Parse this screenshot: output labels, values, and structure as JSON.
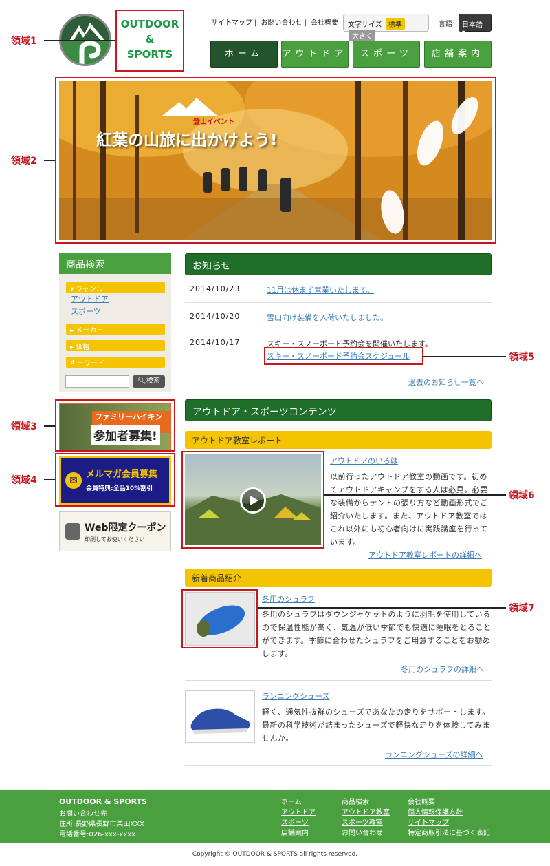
{
  "header": {
    "logo_line1": "OUTDOOR",
    "logo_line2": "&",
    "logo_line3": "SPORTS",
    "util_links": [
      "サイトマップ",
      "お問い合わせ",
      "会社概要"
    ],
    "font_size_label": "文字サイズ",
    "font_size_normal": "標準",
    "font_size_large": "大きく",
    "lang_label": "言語",
    "lang_value": "日本語"
  },
  "nav": [
    {
      "label": "ホーム",
      "active": true
    },
    {
      "label": "アウトドア",
      "active": false
    },
    {
      "label": "スポーツ",
      "active": false
    },
    {
      "label": "店舗案内",
      "active": false
    }
  ],
  "hero": {
    "event_label": "登山イベント",
    "title": "紅葉の山旅に出かけよう!"
  },
  "annotations": [
    "領域1",
    "領域2",
    "領域3",
    "領域4",
    "領域5",
    "領域6",
    "領域7"
  ],
  "sidebar": {
    "title": "商品検索",
    "genre_label": "ジャンル",
    "genre_items": [
      "アウトドア",
      "スポーツ"
    ],
    "maker_label": "メーカー",
    "price_label": "価格",
    "keyword_label": "キーワード",
    "search_button": "検索",
    "banner1_line1": "ファミリーハイキング",
    "banner1_line2": "参加者募集!",
    "banner2_line1": "メルマガ会員募集",
    "banner2_line2": "会員特典:全品10%割引",
    "banner3_line1": "Web限定クーポン",
    "banner3_line2": "印刷してお使いください"
  },
  "news": {
    "title": "お知らせ",
    "items": [
      {
        "date": "2014/10/23",
        "text": "11月は休まず営業いたします。"
      },
      {
        "date": "2014/10/20",
        "text": "雪山向け装備を入荷いたしました。"
      },
      {
        "date": "2014/10/17",
        "text": "スキー・スノーボード予約会を開催いたします。",
        "link": "スキー・スノーボード予約会スケジュール"
      }
    ],
    "more": "過去のお知らせ一覧へ"
  },
  "contents": {
    "title": "アウトドア・スポーツコンテンツ",
    "report": {
      "heading": "アウトドア教室レポート",
      "item_title": "アウトドアのいろは",
      "body": "以前行ったアウトドア教室の動画です。初めてアウトドアキャンプをする人は必見。必要な装備からテントの張り方など動画形式でご紹介いたします。また、アウトドア教室ではこれ以外にも初心者向けに実践講座を行っています。",
      "more": "アウトドア教室レポートの詳細へ"
    },
    "new_products": {
      "heading": "新着商品紹介",
      "items": [
        {
          "title": "冬用のシュラフ",
          "body": "冬用のシュラフはダウンジャケットのように羽毛を使用しているので保温性能が高く、気温が低い季節でも快適に睡眠をとることができます。季節に合わせたシュラフをご用意することをお勧めします。",
          "more": "冬用のシュラフの詳細へ"
        },
        {
          "title": "ランニングシューズ",
          "body": "軽く、通気性抜群のシューズであなたの走りをサポートします。最新の科学技術が詰まったシューズで軽快な走りを体験してみませんか。",
          "more": "ランニングシューズの詳細へ"
        }
      ]
    }
  },
  "footer": {
    "brand": "OUTDOOR & SPORTS",
    "contact_label": "お問い合わせ先",
    "address": "住所:長野県長野市栗田XXX",
    "phone": "電話番号:026-xxx-xxxx",
    "col1": [
      "ホーム",
      "アウトドア",
      "スポーツ",
      "店舗案内"
    ],
    "col2": [
      "商品検索",
      "アウトドア教室",
      "スポーツ教室",
      "お問い合わせ"
    ],
    "col3": [
      "会社概要",
      "個人情報保護方針",
      "サイトマップ",
      "特定商取引法に基づく表記"
    ],
    "copyright": "Copyright © OUTDOOR & SPORTS all rights reserved."
  },
  "colors": {
    "brand_green": "#4aa03f",
    "dark_green": "#1f6e2a",
    "accent_yellow": "#f5c400",
    "annotation_red": "#c8171e"
  }
}
